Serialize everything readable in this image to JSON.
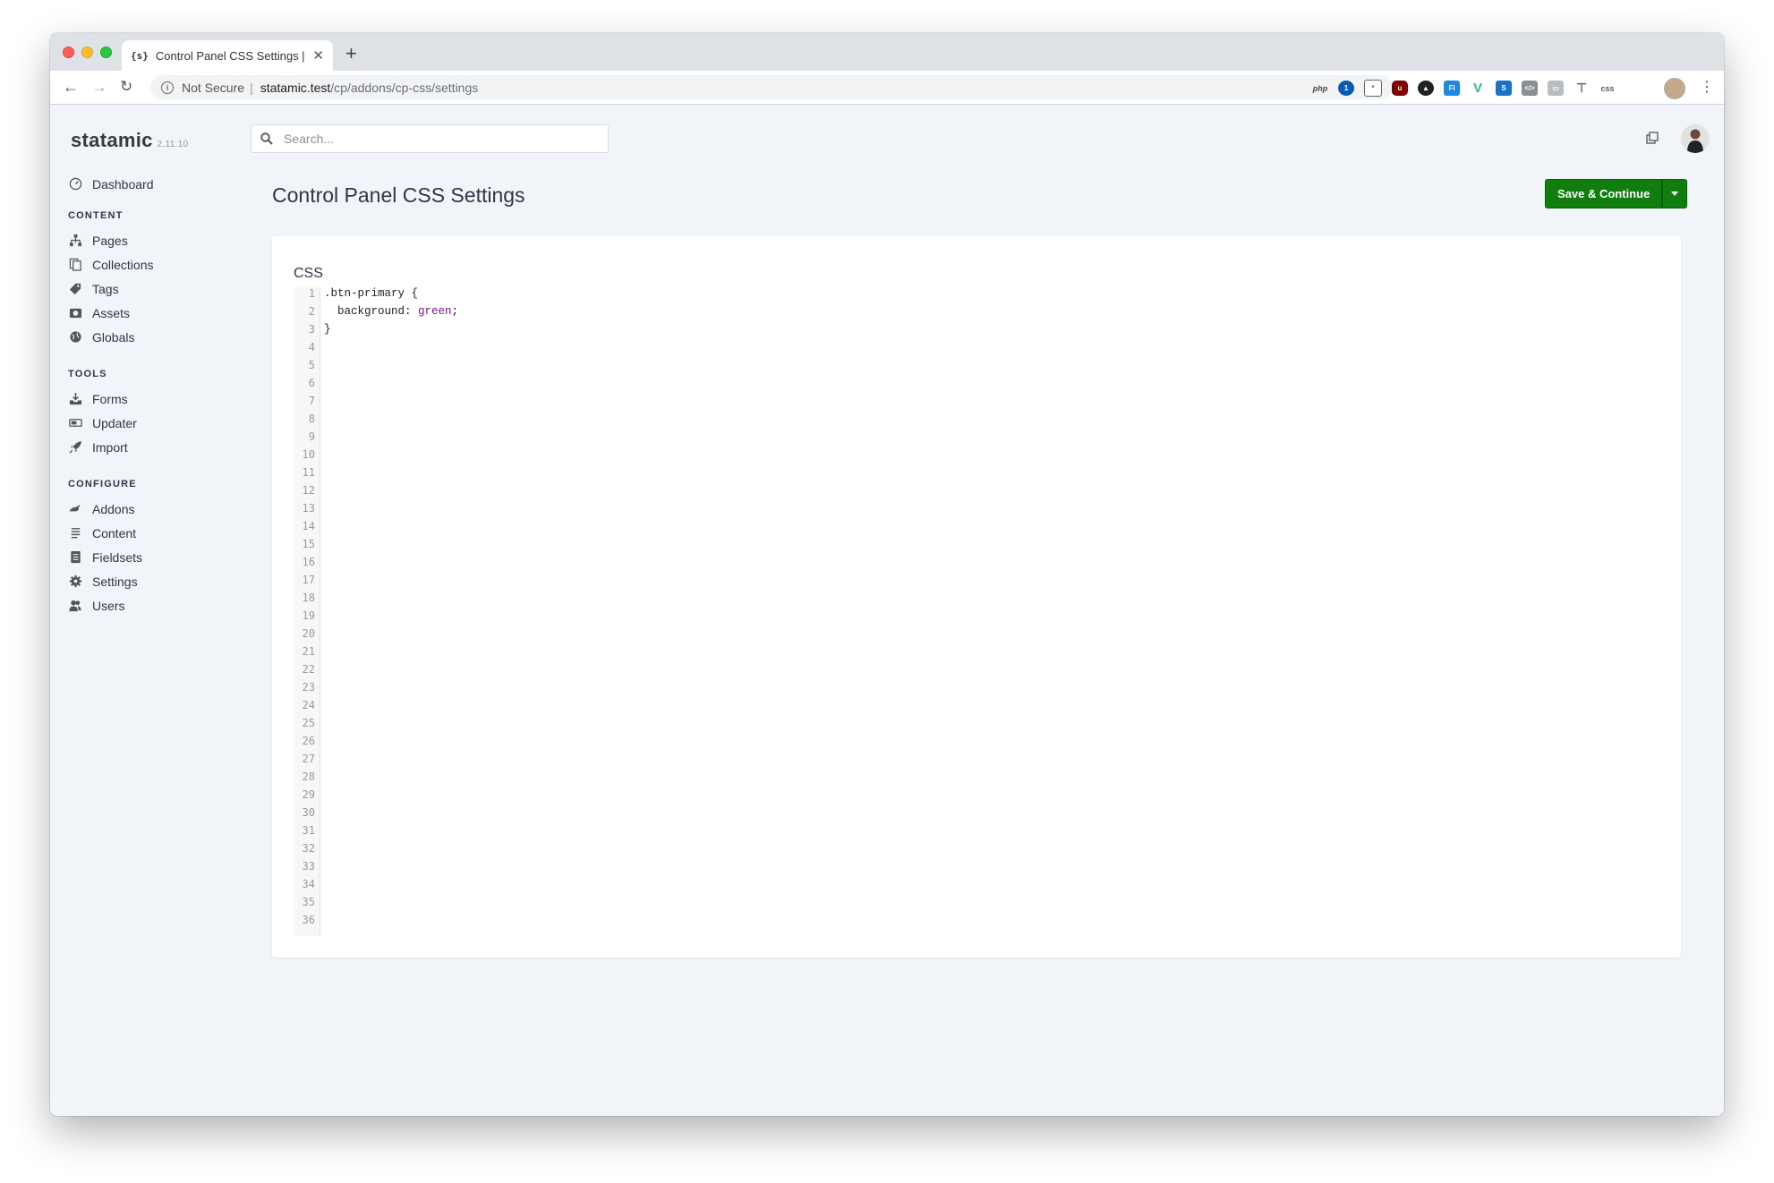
{
  "browser": {
    "tab_title": "Control Panel CSS Settings | St",
    "tab_favicon": "{s}",
    "security_label": "Not Secure",
    "url_host": "statamic.test",
    "url_path": "/cp/addons/cp-css/settings",
    "extension_icons": [
      "php-icon",
      "1password-icon",
      "extension-icon",
      "ublock-icon",
      "dark-reader-icon",
      "fl-icon",
      "vue-devtools-icon",
      "s-icon",
      "code-icon",
      "comment-icon",
      "tools-icon",
      "css-icon"
    ]
  },
  "app": {
    "logo": "statamic",
    "version": "2.11.10",
    "search_placeholder": "Search..."
  },
  "sidebar": {
    "dashboard": "Dashboard",
    "sections": [
      {
        "title": "CONTENT",
        "items": [
          "Pages",
          "Collections",
          "Tags",
          "Assets",
          "Globals"
        ]
      },
      {
        "title": "TOOLS",
        "items": [
          "Forms",
          "Updater",
          "Import"
        ]
      },
      {
        "title": "CONFIGURE",
        "items": [
          "Addons",
          "Content",
          "Fieldsets",
          "Settings",
          "Users"
        ]
      }
    ]
  },
  "main": {
    "page_title": "Control Panel CSS Settings",
    "save_label": "Save & Continue",
    "field_label": "CSS",
    "editor": {
      "line_count": 36,
      "code": {
        "line1": ".btn-primary {",
        "line2_prop": "  background: ",
        "line2_value": "green",
        "line2_end": ";",
        "line3": "}"
      }
    }
  },
  "colors": {
    "save_button": "#0f7e0f",
    "css_value_keyword": "#7a1a8c",
    "app_background": "#f1f4f8"
  }
}
